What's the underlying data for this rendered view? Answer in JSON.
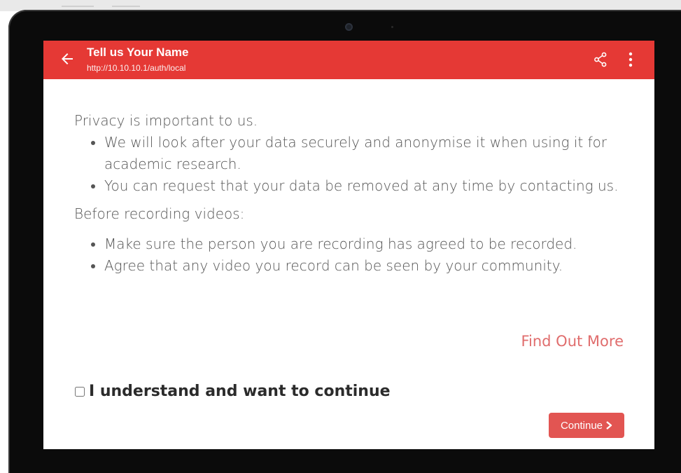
{
  "app_bar": {
    "title": "Tell us Your Name",
    "url": "http://10.10.10.1/auth/local",
    "icons": {
      "back": "arrow-left-icon",
      "share": "share-icon",
      "more": "more-vertical-icon"
    }
  },
  "privacy": {
    "heading": "Privacy is important to us.",
    "items": [
      "We will look after your data securely and anonymise it when using it for academic research.",
      "You can request that your data be removed at any time by contacting us."
    ]
  },
  "recording": {
    "heading": "Before recording videos:",
    "items": [
      "Make sure the person you are recording has agreed to be recorded.",
      "Agree that any video you record can be seen by your community."
    ]
  },
  "find_more_label": "Find Out More",
  "consent": {
    "label": "I understand and want to continue",
    "checked": false
  },
  "continue_label": "Continue",
  "colors": {
    "app_bar": "#e53935",
    "button": "#e25552",
    "link": "#e06d6d",
    "bezel": "#0b0b0b"
  }
}
